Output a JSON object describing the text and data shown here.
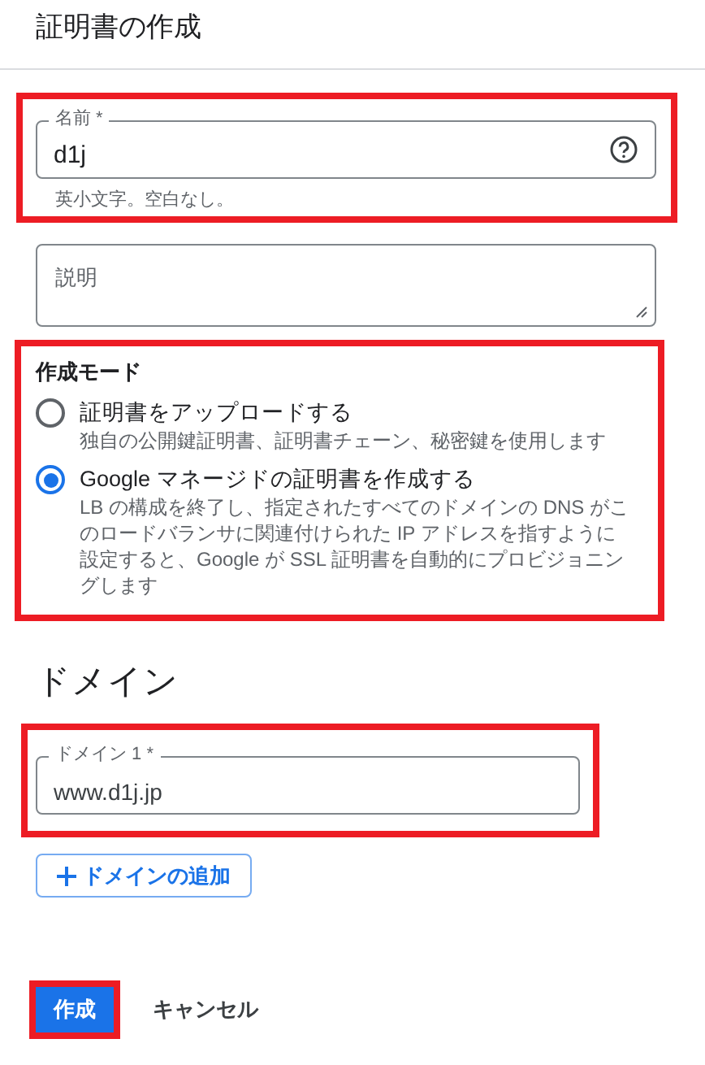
{
  "header": {
    "title": "証明書の作成"
  },
  "name_field": {
    "label": "名前 *",
    "value": "d1j",
    "hint": "英小文字。空白なし。",
    "highlighted": true
  },
  "description_field": {
    "placeholder": "説明"
  },
  "mode": {
    "title": "作成モード",
    "highlighted": true,
    "options": [
      {
        "label": "証明書をアップロードする",
        "description": "独自の公開鍵証明書、証明書チェーン、秘密鍵を使用します",
        "selected": false
      },
      {
        "label": "Google マネージドの証明書を作成する",
        "description": "LB の構成を終了し、指定されたすべてのドメインの DNS がこのロードバランサに関連付けられた IP アドレスを指すように設定すると、Google が SSL 証明書を自動的にプロビジョニングします",
        "selected": true
      }
    ]
  },
  "domains": {
    "title": "ドメイン",
    "highlighted": true,
    "fields": [
      {
        "label": "ドメイン 1 *",
        "value": "www.d1j.jp"
      }
    ],
    "add_button": "ドメインの追加"
  },
  "actions": {
    "create": "作成",
    "create_highlighted": true,
    "cancel": "キャンセル"
  }
}
